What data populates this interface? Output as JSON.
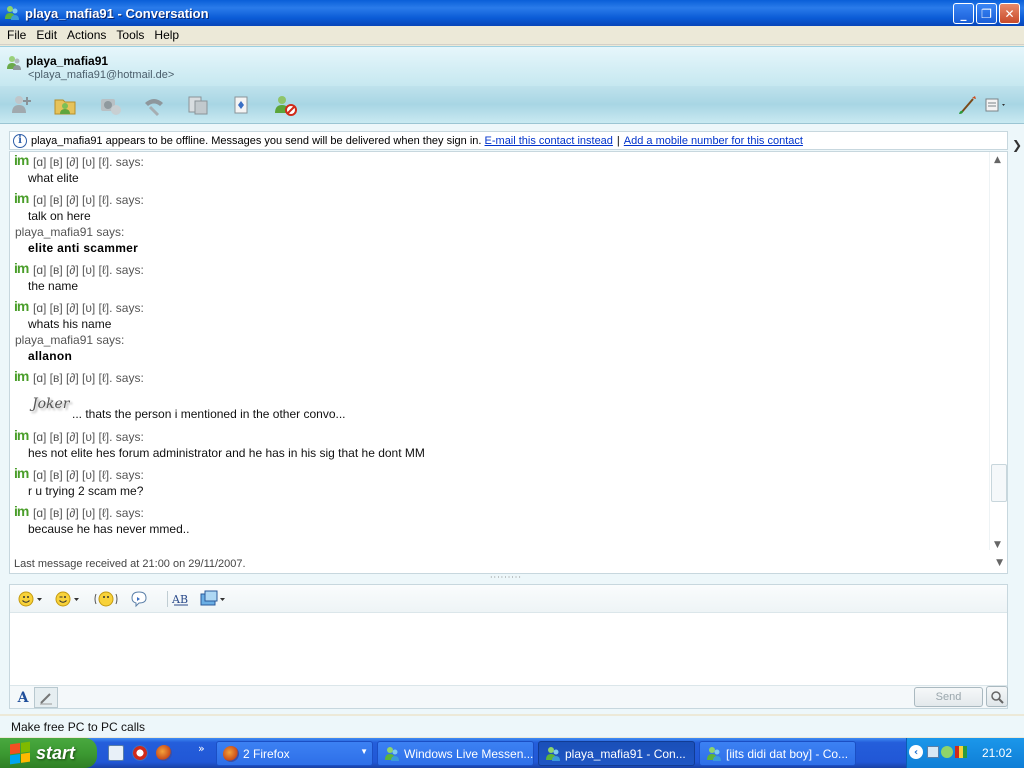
{
  "window": {
    "title": "playa_mafia91 - Conversation",
    "minimize_label": "_",
    "maximize_label": "❐",
    "close_label": "✕"
  },
  "menu": {
    "items": [
      "File",
      "Edit",
      "Actions",
      "Tools",
      "Help"
    ]
  },
  "contact": {
    "name": "playa_mafia91",
    "email": "<playa_mafia91@hotmail.de>"
  },
  "toolbar": {
    "icons": [
      "invite-contact-icon",
      "share-files-icon",
      "video-call-icon",
      "phone-call-icon",
      "activities-icon",
      "games-icon",
      "block-contact-icon",
      "background-brush-icon",
      "display-options-icon"
    ]
  },
  "infobar": {
    "message": "playa_mafia91 appears to be offline. Messages you send will be delivered when they sign in.",
    "email_link": "E-mail this contact instead",
    "separator": "|",
    "mobile_link": "Add a mobile number for this contact"
  },
  "conversation": {
    "other_sender": "[ɑ] [в] [∂] [υ] [ℓ]. says:",
    "contact_sender": "playa_mafia91 says:",
    "im_icon_text": "im",
    "messages": [
      {
        "text": "what elite"
      },
      {
        "text": "talk on here"
      },
      {
        "text": "elite anti scammer"
      },
      {
        "text": "the name"
      },
      {
        "text": "whats his name"
      },
      {
        "text": "allanon"
      },
      {
        "text": "... thats the person i mentioned in the other convo..."
      },
      {
        "text": "hes not elite hes forum administrator and he has in his sig that he dont MM"
      },
      {
        "text": "r u trying 2 scam me?"
      },
      {
        "text": "because he has never mmed.."
      }
    ],
    "joker_image_text": "Joker",
    "status": "Last message received at 21:00 on 29/11/2007."
  },
  "compose": {
    "send_label": "Send",
    "font_label": "A"
  },
  "ad": {
    "text": "Make free PC to PC calls"
  },
  "taskbar": {
    "start_label": "start",
    "quick_more": "»",
    "tasks": [
      {
        "label": "2 Firefox"
      },
      {
        "label": "Windows Live Messen..."
      },
      {
        "label": "playa_mafia91 - Con..."
      },
      {
        "label": "[iits didi dat boy] - Co..."
      }
    ],
    "clock": "21:02"
  },
  "colors": {
    "title_bar": "#0a5fd8",
    "header_bg": "#c6e8f0",
    "link": "#0033cc",
    "im_green": "#4a9e2a",
    "taskbar": "#245edb",
    "start_green": "#3c9a32"
  }
}
